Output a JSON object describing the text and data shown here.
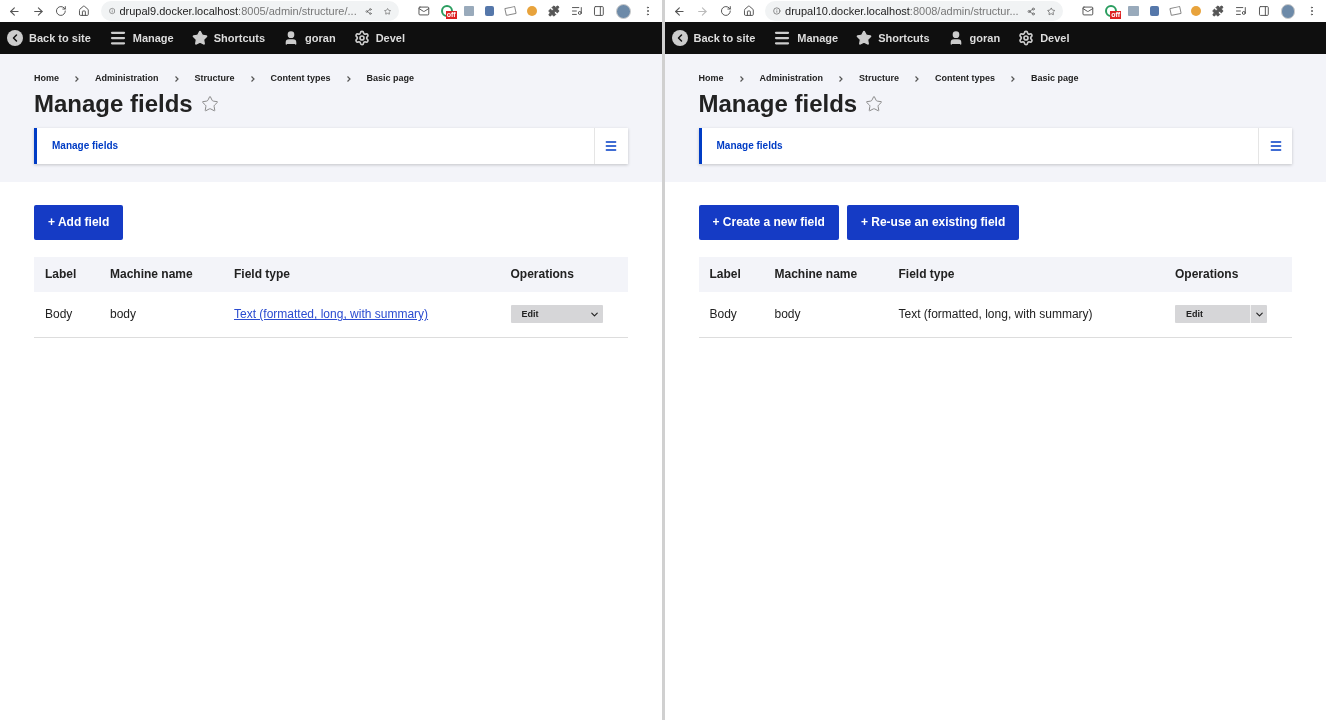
{
  "panes": [
    {
      "browser": {
        "forward_enabled": true,
        "url_host": "drupal9.docker.localhost",
        "url_rest": ":8005/admin/structure/...",
        "extension_badge": "off"
      },
      "toolbar": [
        "Back to site",
        "Manage",
        "Shortcuts",
        "goran",
        "Devel"
      ],
      "breadcrumb": [
        "Home",
        "Administration",
        "Structure",
        "Content types",
        "Basic page"
      ],
      "title": "Manage fields",
      "tabs": [
        {
          "label": "Manage fields",
          "selected": true
        }
      ],
      "actions": [
        "+ Add field"
      ],
      "table": {
        "columns": [
          "Label",
          "Machine name",
          "Field type",
          "Operations"
        ],
        "rows": [
          {
            "label": "Body",
            "machine_name": "body",
            "field_type": "Text (formatted, long, with summary)",
            "field_type_is_link": true,
            "operation": "Edit",
            "split": false
          }
        ]
      }
    },
    {
      "browser": {
        "forward_enabled": false,
        "url_host": "drupal10.docker.localhost",
        "url_rest": ":8008/admin/structur...",
        "extension_badge": "off"
      },
      "toolbar": [
        "Back to site",
        "Manage",
        "Shortcuts",
        "goran",
        "Devel"
      ],
      "breadcrumb": [
        "Home",
        "Administration",
        "Structure",
        "Content types",
        "Basic page"
      ],
      "title": "Manage fields",
      "tabs": [
        {
          "label": "Manage fields",
          "selected": true
        }
      ],
      "actions": [
        "+ Create a new field",
        "+ Re-use an existing field"
      ],
      "table": {
        "columns": [
          "Label",
          "Machine name",
          "Field type",
          "Operations"
        ],
        "rows": [
          {
            "label": "Body",
            "machine_name": "body",
            "field_type": "Text (formatted, long, with summary)",
            "field_type_is_link": false,
            "operation": "Edit",
            "split": true
          }
        ]
      }
    }
  ]
}
